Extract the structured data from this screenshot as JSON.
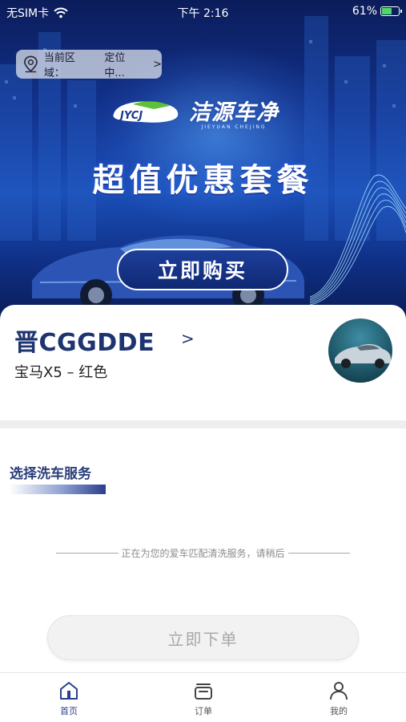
{
  "status_bar": {
    "carrier": "无SIM卡",
    "time": "下午 2:16",
    "battery": "61%",
    "battery_level": 0.61
  },
  "location": {
    "label": "当前区域：",
    "value": "定位中...",
    "chevron": ">"
  },
  "banner": {
    "brand_cn": "洁源车净",
    "brand_en": "JIEYUAN CHEJING",
    "headline": "超值优惠套餐",
    "buy_button": "立即购买"
  },
  "vehicle": {
    "plate": "晋CGGDDE",
    "chevron": ">",
    "model": "宝马X5 – 红色"
  },
  "service": {
    "title": "选择洗车服务",
    "matching_text": "正在为您的爱车匹配清洗服务，请稍后",
    "order_button": "立即下单"
  },
  "tabs": [
    {
      "label": "首页",
      "icon": "home-icon",
      "active": true
    },
    {
      "label": "订单",
      "icon": "orders-icon",
      "active": false
    },
    {
      "label": "我的",
      "icon": "profile-icon",
      "active": false
    }
  ],
  "colors": {
    "primary": "#2a3f8c",
    "plate_text": "#1e3470",
    "banner_dark": "#0b1c5a",
    "disabled_button": "#f2f2f2",
    "battery_green": "#4cd964"
  }
}
